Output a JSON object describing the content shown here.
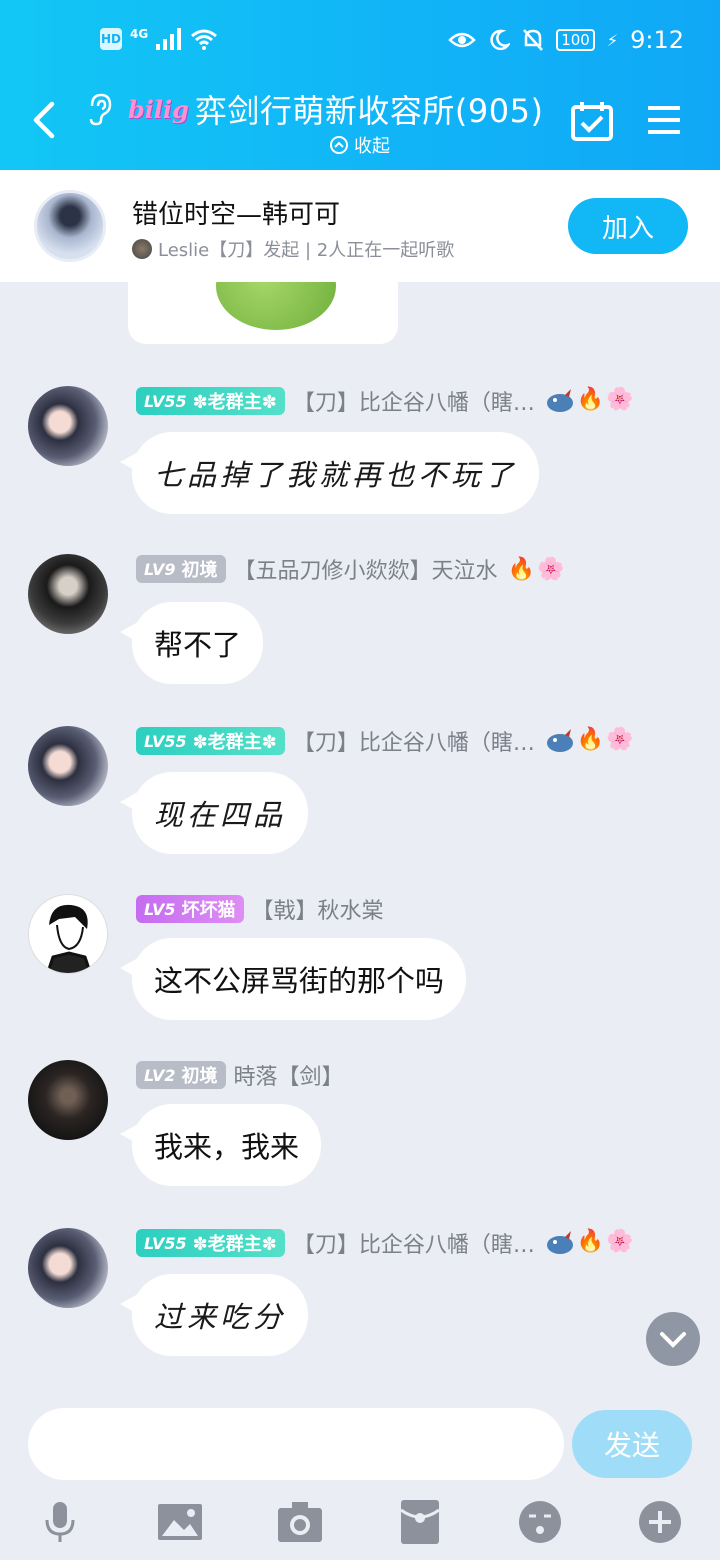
{
  "status_bar": {
    "hd": "HD",
    "network": "4G",
    "battery": "100",
    "time": "9:12"
  },
  "header": {
    "brand_text": "bilig",
    "title": "弈剑行萌新收容所(905)",
    "collapse_label": "收起"
  },
  "music_banner": {
    "song": "错位时空—韩可可",
    "subtitle": "Leslie【刀】发起 | 2人正在一起听歌",
    "join_label": "加入"
  },
  "messages": [
    {
      "level": "LV55",
      "title": "✽老群主✽",
      "sender": "【刀】比企谷八幡（瞎…",
      "text": "七品掉了我就再也不玩了",
      "style": "hand"
    },
    {
      "level": "LV9",
      "title": "初境",
      "sender": "【五品刀修小欻欻】天泣水",
      "text": "帮不了",
      "style": "normal"
    },
    {
      "level": "LV55",
      "title": "✽老群主✽",
      "sender": "【刀】比企谷八幡（瞎…",
      "text": "现在四品",
      "style": "hand"
    },
    {
      "level": "LV5",
      "title": "坏坏猫",
      "sender": "【戟】秋水棠",
      "text": "这不公屏骂街的那个吗",
      "style": "normal"
    },
    {
      "level": "LV2",
      "title": "初境",
      "sender": "時落【剑】",
      "text": "我来，我来",
      "style": "normal"
    },
    {
      "level": "LV55",
      "title": "✽老群主✽",
      "sender": "【刀】比企谷八幡（瞎…",
      "text": "过来吃分",
      "style": "hand"
    }
  ],
  "input": {
    "placeholder": "",
    "send_label": "发送"
  },
  "colors": {
    "header_blue": "#12b7f5",
    "level_teal": "#2ccfc0",
    "level_gray": "#b7bcc7",
    "level_purple": "#c56cf0",
    "chat_bg": "#eaedf4"
  },
  "icons": [
    "back-icon",
    "ear-icon",
    "calendar-check-icon",
    "menu-icon",
    "mic-icon",
    "image-icon",
    "camera-icon",
    "red-packet-icon",
    "emoji-icon",
    "plus-icon",
    "chevron-down-icon"
  ]
}
